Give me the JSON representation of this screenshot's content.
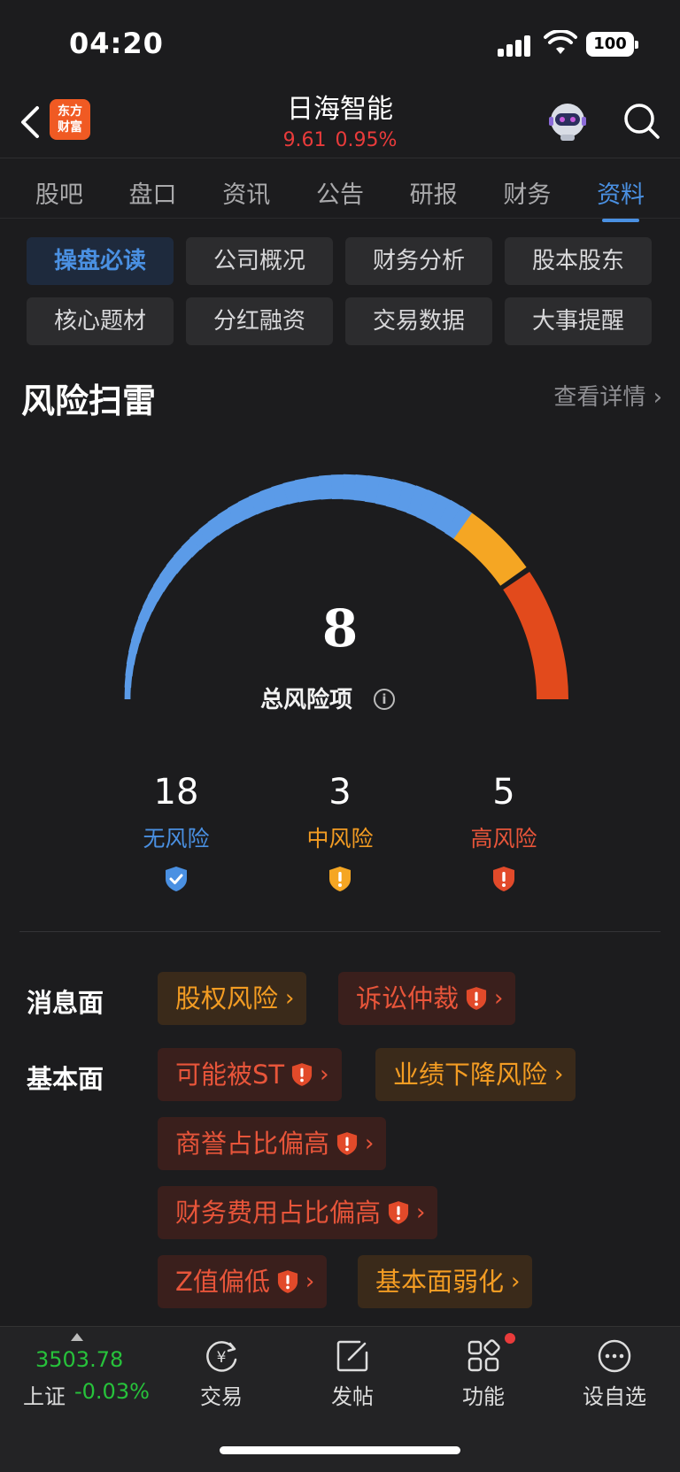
{
  "status_bar": {
    "time": "04:20",
    "battery": "100"
  },
  "header": {
    "logo_text_line1": "东方",
    "logo_text_line2": "财富",
    "stock_name": "日海智能",
    "price": "9.61",
    "change": "0.95%",
    "price_color": "#e93b3b"
  },
  "tabs": [
    {
      "label": "股吧"
    },
    {
      "label": "盘口"
    },
    {
      "label": "资讯"
    },
    {
      "label": "公告"
    },
    {
      "label": "研报"
    },
    {
      "label": "财务"
    },
    {
      "label": "资料",
      "active": true
    }
  ],
  "sub_buttons": [
    {
      "label": "操盘必读",
      "active": true
    },
    {
      "label": "公司概况"
    },
    {
      "label": "财务分析"
    },
    {
      "label": "股本股东"
    },
    {
      "label": "核心题材"
    },
    {
      "label": "分红融资"
    },
    {
      "label": "交易数据"
    },
    {
      "label": "大事提醒"
    }
  ],
  "risk": {
    "title": "风险扫雷",
    "detail_link": "查看详情 ›",
    "total": "8",
    "total_label": "总风险项",
    "gauge_fractions": {
      "low": 0.6923,
      "medium": 0.1154,
      "high": 0.1923
    },
    "colors": {
      "low": "#5b9be8",
      "medium": "#f5a623",
      "high": "#e24a1c"
    },
    "stats": [
      {
        "num": "18",
        "label": "无风险",
        "color": "#4a90e2"
      },
      {
        "num": "3",
        "label": "中风险",
        "color": "#f39c23"
      },
      {
        "num": "5",
        "label": "高风险",
        "color": "#e8553a"
      }
    ]
  },
  "categories": {
    "news": {
      "label": "消息面",
      "tags": [
        {
          "text": "股权风险",
          "level": "medium"
        },
        {
          "text": "诉讼仲裁",
          "level": "high"
        }
      ]
    },
    "fundamental": {
      "label": "基本面",
      "tags": [
        {
          "text": "可能被ST",
          "level": "high"
        },
        {
          "text": "业绩下降风险",
          "level": "medium"
        },
        {
          "text": "商誉占比偏高",
          "level": "high"
        },
        {
          "text": "财务费用占比偏高",
          "level": "high"
        },
        {
          "text": "Z值偏低",
          "level": "high"
        },
        {
          "text": "基本面弱化",
          "level": "medium"
        }
      ]
    }
  },
  "bottom_bar": {
    "index_value": "3503.78",
    "index_name": "上证",
    "index_change": "-0.03%",
    "nav": [
      {
        "label": "交易"
      },
      {
        "label": "发帖"
      },
      {
        "label": "功能"
      },
      {
        "label": "设自选"
      }
    ]
  }
}
